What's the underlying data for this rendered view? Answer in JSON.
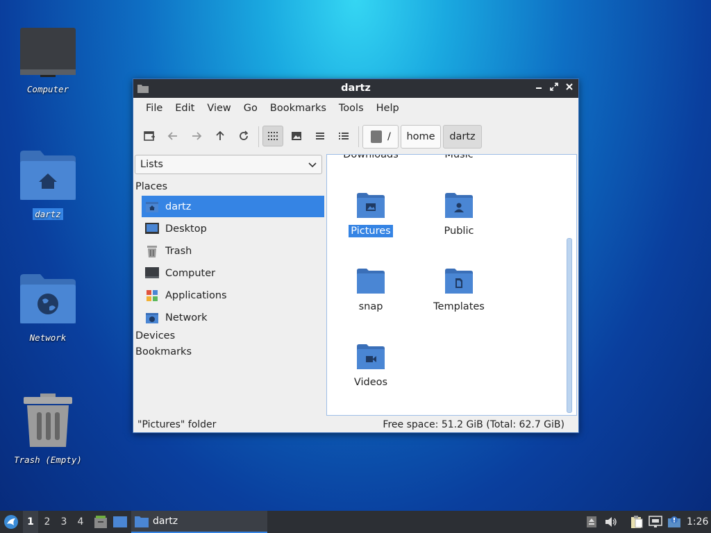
{
  "desktop": {
    "icons": [
      {
        "label": "Computer",
        "icon": "computer-icon"
      },
      {
        "label": "dartz",
        "icon": "home-folder-icon"
      },
      {
        "label": "Network",
        "icon": "network-folder-icon"
      },
      {
        "label": "Trash (Empty)",
        "icon": "trash-icon"
      }
    ]
  },
  "window": {
    "title": "dartz",
    "menus": [
      "File",
      "Edit",
      "View",
      "Go",
      "Bookmarks",
      "Tools",
      "Help"
    ],
    "path": {
      "root": "/",
      "parts": [
        "home",
        "dartz"
      ]
    },
    "sidebar": {
      "mode": "Lists",
      "places_header": "Places",
      "places": [
        {
          "label": "dartz",
          "icon": "home-icon"
        },
        {
          "label": "Desktop",
          "icon": "desktop-icon"
        },
        {
          "label": "Trash",
          "icon": "trash-icon"
        },
        {
          "label": "Computer",
          "icon": "computer-icon"
        },
        {
          "label": "Applications",
          "icon": "applications-icon"
        },
        {
          "label": "Network",
          "icon": "network-icon"
        }
      ],
      "devices_header": "Devices",
      "bookmarks_header": "Bookmarks"
    },
    "files": [
      {
        "label": "Downloads",
        "icon": "downloads-folder-icon"
      },
      {
        "label": "Music",
        "icon": "music-folder-icon"
      },
      {
        "label": "Pictures",
        "icon": "pictures-folder-icon",
        "selected": true
      },
      {
        "label": "Public",
        "icon": "public-folder-icon"
      },
      {
        "label": "snap",
        "icon": "folder-icon"
      },
      {
        "label": "Templates",
        "icon": "templates-folder-icon"
      },
      {
        "label": "Videos",
        "icon": "videos-folder-icon"
      }
    ],
    "status_left": "\"Pictures\" folder",
    "status_right": "Free space: 51.2 GiB (Total: 62.7 GiB)"
  },
  "taskbar": {
    "workspaces": [
      "1",
      "2",
      "3",
      "4"
    ],
    "active_workspace": "1",
    "task_label": "dartz",
    "clock": "1:26"
  },
  "colors": {
    "accent": "#3584e4",
    "folder": "#4a86d4",
    "titlebar": "#2d3036"
  }
}
